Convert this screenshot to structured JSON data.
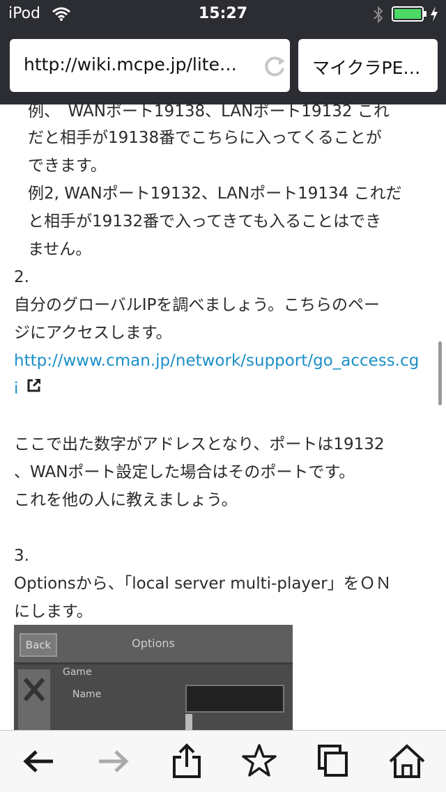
{
  "status_bar": {
    "device": "iPod",
    "time": "15:27",
    "battery_color": "#4cd964"
  },
  "browser": {
    "url": "http://wiki.mcpe.jp/lite…",
    "tab_title": "マイクラPE…"
  },
  "content": {
    "lines": [
      "例、　WANポート19138、LANポート19132 これ",
      "だと相手が19138番でこちらに入ってくることが",
      "できます。",
      "例2, WANポート19132、LANポート19134 これだ",
      "と相手が19132番で入ってきても入ることはでき",
      "ません。",
      "2.",
      "自分のグローバルIPを調べましょう。こちらのペー",
      "ジにアクセスします。",
      "http://www.cman.jp/network/support/go_access.cg",
      "i",
      "ここで出た数字がアドレスとなり、ポートは19132",
      "、WANポート設定した場合はそのポートです。",
      "これを他の人に教えましょう。",
      "3.",
      "Optionsから、「local server multi-player」をＯＮ",
      "にします。"
    ],
    "image": {
      "back_label": "Back",
      "title": "Options",
      "game_label": "Game",
      "name_label": "Name"
    }
  },
  "toolbar": {
    "icons": [
      "back-arrow-icon",
      "forward-arrow-icon",
      "share-icon",
      "bookmark-star-icon",
      "tabs-icon",
      "home-icon"
    ]
  },
  "colors": {
    "link": "#1b8fc7",
    "topbar": "#2b2d33"
  }
}
